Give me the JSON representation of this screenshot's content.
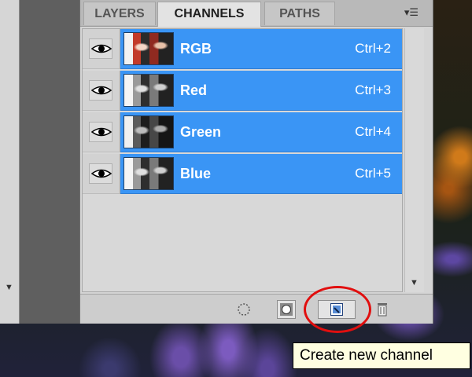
{
  "tabs": [
    {
      "label": "LAYERS",
      "active": false
    },
    {
      "label": "CHANNELS",
      "active": true
    },
    {
      "label": "PATHS",
      "active": false
    }
  ],
  "panel_menu_icon": "panel-menu-icon",
  "channels": [
    {
      "name": "RGB",
      "shortcut": "Ctrl+2",
      "visible": true,
      "thumbnail": "color"
    },
    {
      "name": "Red",
      "shortcut": "Ctrl+3",
      "visible": true,
      "thumbnail": "grayscale"
    },
    {
      "name": "Green",
      "shortcut": "Ctrl+4",
      "visible": true,
      "thumbnail": "grayscale"
    },
    {
      "name": "Blue",
      "shortcut": "Ctrl+5",
      "visible": true,
      "thumbnail": "grayscale"
    }
  ],
  "bottom_buttons": [
    {
      "icon": "load-channel-as-selection-icon"
    },
    {
      "icon": "save-selection-as-channel-icon"
    },
    {
      "icon": "create-new-channel-icon"
    },
    {
      "icon": "delete-channel-icon"
    }
  ],
  "tooltip": "Create new channel",
  "colors": {
    "selection_blue": "#3a95f5",
    "highlight_red": "#e10f0f",
    "tooltip_bg": "#ffffe1"
  }
}
